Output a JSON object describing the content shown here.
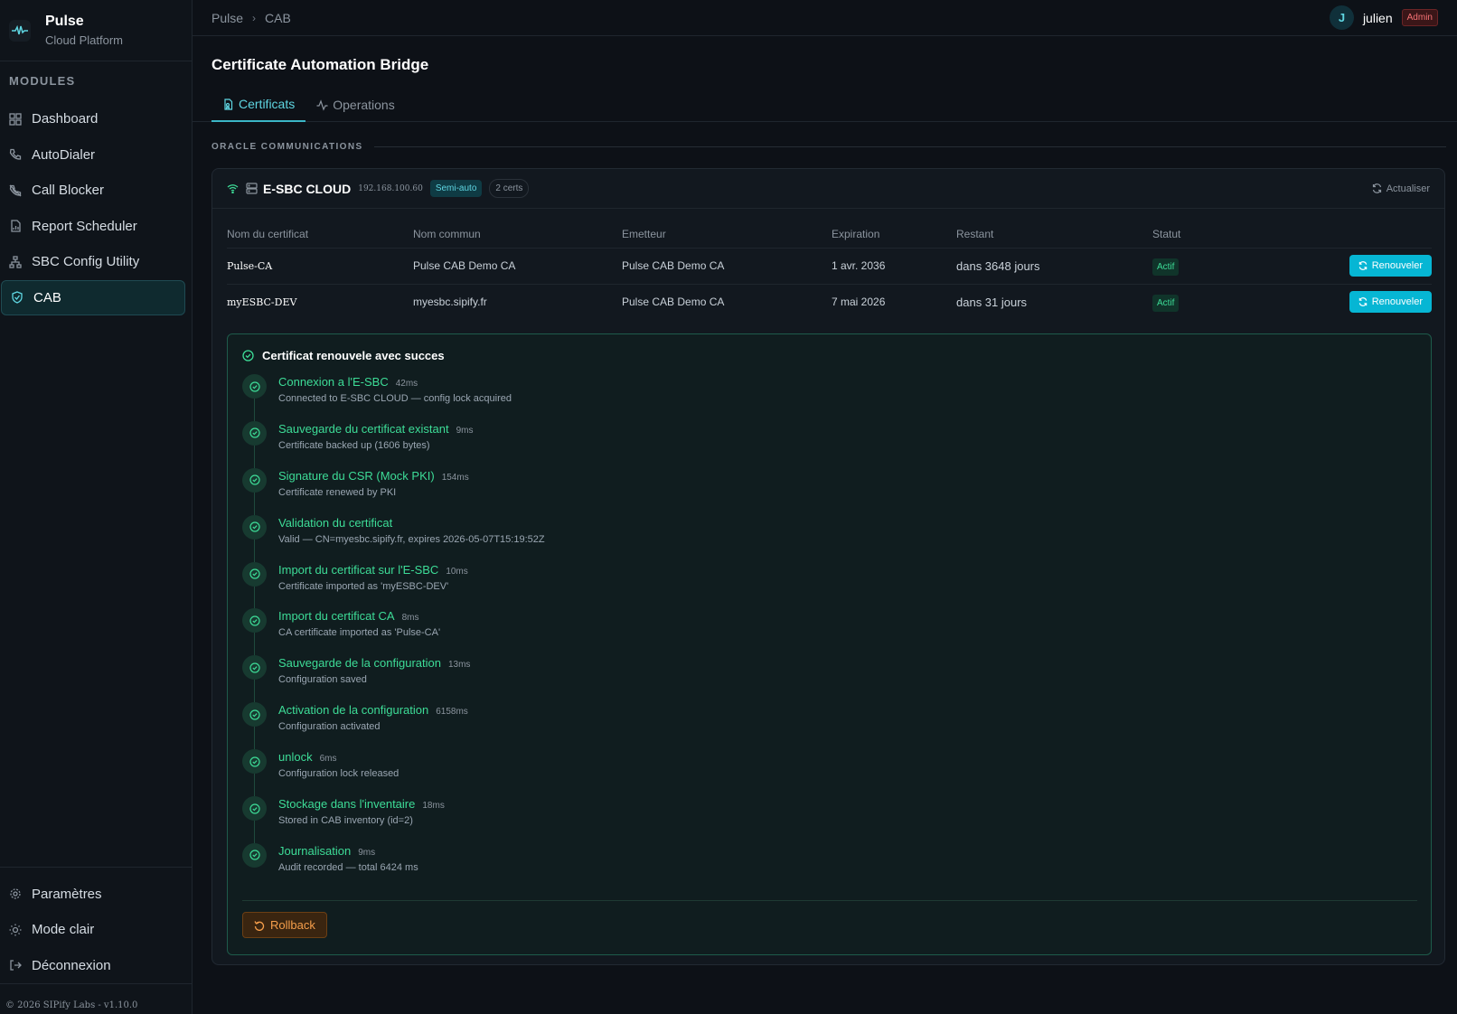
{
  "brand": {
    "name": "Pulse",
    "subtitle": "Cloud Platform"
  },
  "sidebar": {
    "section_label": "MODULES",
    "items": [
      {
        "label": "Dashboard",
        "icon": "grid-icon"
      },
      {
        "label": "AutoDialer",
        "icon": "phone-icon"
      },
      {
        "label": "Call Blocker",
        "icon": "phone-off-icon"
      },
      {
        "label": "Report Scheduler",
        "icon": "file-chart-icon"
      },
      {
        "label": "SBC Config Utility",
        "icon": "network-icon"
      },
      {
        "label": "CAB",
        "icon": "shield-check-icon",
        "active": true
      }
    ],
    "bottom_items": [
      {
        "label": "Paramètres",
        "icon": "gear-icon"
      },
      {
        "label": "Mode clair",
        "icon": "sun-icon"
      },
      {
        "label": "Déconnexion",
        "icon": "logout-icon"
      }
    ],
    "footer": "© 2026 SIPify Labs - v1.10.0"
  },
  "topbar": {
    "breadcrumb": [
      "Pulse",
      "CAB"
    ],
    "user": {
      "initial": "J",
      "name": "julien",
      "role": "Admin"
    }
  },
  "page": {
    "title": "Certificate Automation Bridge",
    "tabs": [
      {
        "label": "Certificats",
        "active": true
      },
      {
        "label": "Operations",
        "active": false
      }
    ],
    "group_label": "ORACLE COMMUNICATIONS"
  },
  "device": {
    "name": "E-SBC CLOUD",
    "ip": "192.168.100.60",
    "mode": "Semi-auto",
    "cert_count": "2 certs",
    "refresh_label": "Actualiser"
  },
  "table": {
    "headers": [
      "Nom du certificat",
      "Nom commun",
      "Emetteur",
      "Expiration",
      "Restant",
      "Statut"
    ],
    "rows": [
      {
        "name": "Pulse-CA",
        "cn": "Pulse CAB Demo CA",
        "issuer": "Pulse CAB Demo CA",
        "expiration": "1 avr. 2036",
        "remaining": "dans 3648 jours",
        "status": "Actif",
        "action": "Renouveler"
      },
      {
        "name": "myESBC-DEV",
        "cn": "myesbc.sipify.fr",
        "issuer": "Pulse CAB Demo CA",
        "expiration": "7 mai 2026",
        "remaining": "dans 31 jours",
        "status": "Actif",
        "action": "Renouveler"
      }
    ]
  },
  "result": {
    "title": "Certificat renouvele avec succes",
    "steps": [
      {
        "title": "Connexion a l'E-SBC",
        "time": "42ms",
        "detail": "Connected to E-SBC CLOUD — config lock acquired"
      },
      {
        "title": "Sauvegarde du certificat existant",
        "time": "9ms",
        "detail": "Certificate backed up (1606 bytes)"
      },
      {
        "title": "Signature du CSR (Mock PKI)",
        "time": "154ms",
        "detail": "Certificate renewed by PKI"
      },
      {
        "title": "Validation du certificat",
        "time": "",
        "detail": "Valid — CN=myesbc.sipify.fr, expires 2026-05-07T15:19:52Z"
      },
      {
        "title": "Import du certificat sur l'E-SBC",
        "time": "10ms",
        "detail": "Certificate imported as 'myESBC-DEV'"
      },
      {
        "title": "Import du certificat CA",
        "time": "8ms",
        "detail": "CA certificate imported as 'Pulse-CA'"
      },
      {
        "title": "Sauvegarde de la configuration",
        "time": "13ms",
        "detail": "Configuration saved"
      },
      {
        "title": "Activation de la configuration",
        "time": "6158ms",
        "detail": "Configuration activated"
      },
      {
        "title": "unlock",
        "time": "6ms",
        "detail": "Configuration lock released"
      },
      {
        "title": "Stockage dans l'inventaire",
        "time": "18ms",
        "detail": "Stored in CAB inventory (id=2)"
      },
      {
        "title": "Journalisation",
        "time": "9ms",
        "detail": "Audit recorded — total 6424 ms"
      }
    ],
    "rollback_label": "Rollback"
  },
  "colors": {
    "accent": "#06b6d4",
    "success": "#3ddc97",
    "warning": "#f59e4b",
    "danger": "#f47174"
  }
}
